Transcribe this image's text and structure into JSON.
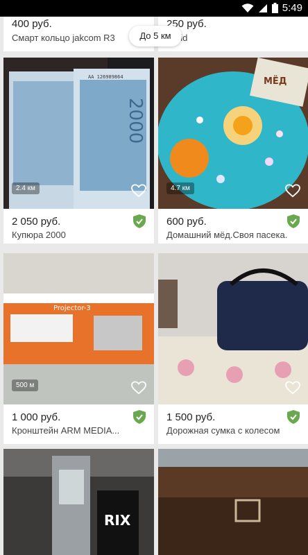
{
  "status": {
    "time": "5:49"
  },
  "filter": {
    "radius_label": "До 5 км"
  },
  "top_partial": {
    "left": {
      "price": "400 руб.",
      "title": "Смарт кольцо jakcom R3"
    },
    "right": {
      "price": "250 руб.",
      "title": "liquid"
    }
  },
  "listings": [
    {
      "price": "2 050 руб.",
      "title": "Купюра 2000",
      "distance": "2.4 км"
    },
    {
      "price": "600 руб.",
      "title": "Домашний мёд.Своя пасека.",
      "distance": "4.7 км"
    },
    {
      "price": "1 000 руб.",
      "title": "Кронштейн ARM MEDIA...",
      "distance": "500 м"
    },
    {
      "price": "1 500 руб.",
      "title": "Дорожная сумка с колесом",
      "distance": ""
    }
  ],
  "image_text": {
    "banknote_serial": "АА 126989864",
    "honey_label": "МЁД",
    "projector_label": "Projector-3",
    "vape_label": "RIX"
  },
  "colors": {
    "verified_badge": "#6aa84f",
    "background": "#e9e9e9"
  },
  "icons": [
    "wifi-icon",
    "signal-icon",
    "battery-icon",
    "verified-shield-icon",
    "favorite-heart-icon"
  ]
}
